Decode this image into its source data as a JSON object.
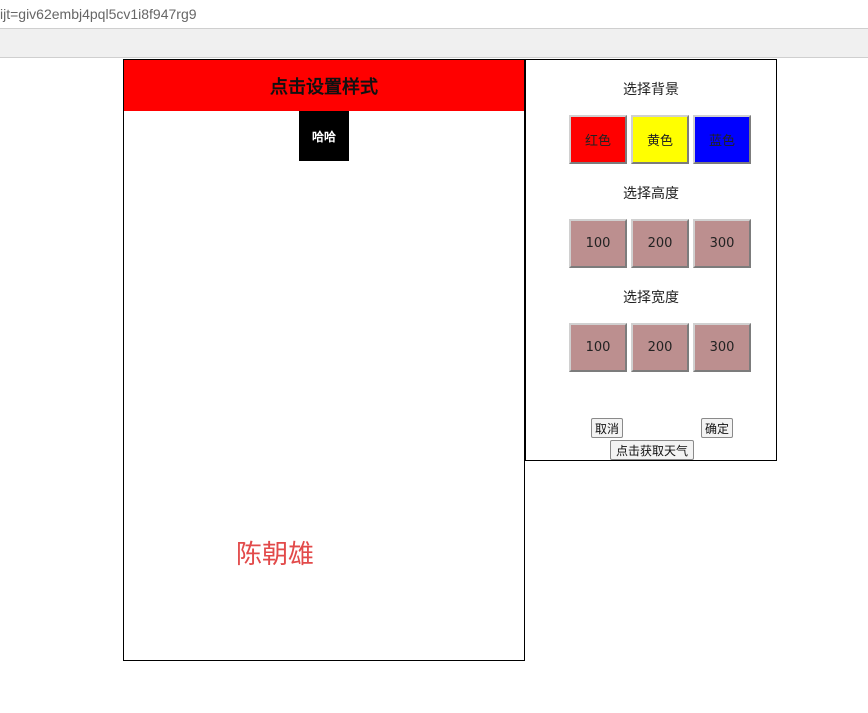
{
  "browser": {
    "url": "ijt=giv62embj4pql5cv1i8f947rg9"
  },
  "left_panel": {
    "header_label": "点击设置样式",
    "box_label": "哈哈",
    "signature": "陈朝雄"
  },
  "right_panel": {
    "background_section": {
      "title": "选择背景",
      "options": [
        {
          "label": "红色",
          "color": "#ff0000"
        },
        {
          "label": "黄色",
          "color": "#ffff00"
        },
        {
          "label": "蓝色",
          "color": "#0000ff"
        }
      ]
    },
    "height_section": {
      "title": "选择高度",
      "options": [
        {
          "label": "100"
        },
        {
          "label": "200"
        },
        {
          "label": "300"
        }
      ]
    },
    "width_section": {
      "title": "选择宽度",
      "options": [
        {
          "label": "100"
        },
        {
          "label": "200"
        },
        {
          "label": "300"
        }
      ]
    },
    "cancel_label": "取消",
    "confirm_label": "确定",
    "weather_label": "点击获取天气"
  }
}
